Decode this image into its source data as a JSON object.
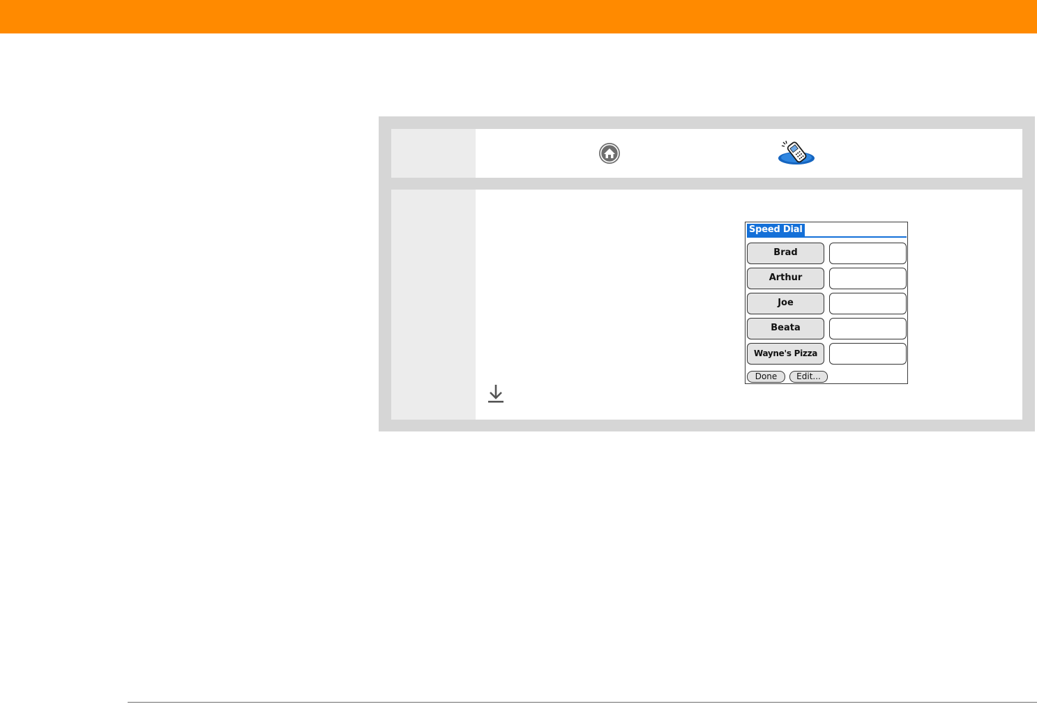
{
  "colors": {
    "header_bar": "#ff8a00",
    "panel_bg": "#d6d6d6",
    "label_cell_bg": "#ececec",
    "title_blue": "#1470d8"
  },
  "steps": [
    {
      "icons": [
        "home-icon",
        "phone-icon"
      ]
    },
    {
      "screen": {
        "title": "Speed Dial",
        "entries": [
          {
            "name": "Brad",
            "number": ""
          },
          {
            "name": "Arthur",
            "number": ""
          },
          {
            "name": "Joe",
            "number": ""
          },
          {
            "name": "Beata",
            "number": ""
          },
          {
            "name": "Wayne's Pizza",
            "number": ""
          }
        ],
        "buttons": {
          "done": "Done",
          "edit": "Edit..."
        }
      },
      "icons": [
        "down-arrow-icon"
      ]
    }
  ]
}
